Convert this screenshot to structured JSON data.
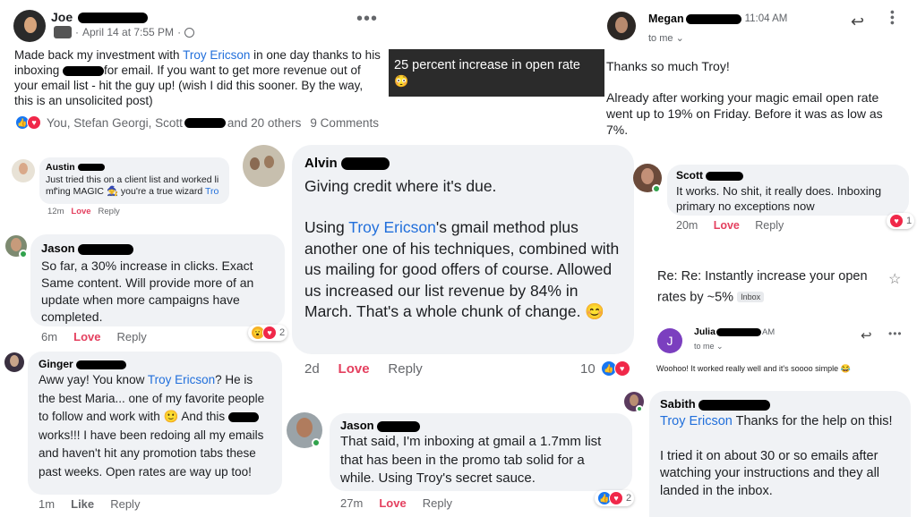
{
  "post": {
    "name": "Joe",
    "date": "April 14 at 7:55 PM",
    "sep": "·",
    "globe_icon": "globe-icon",
    "text_1": "Made back my investment with ",
    "link": "Troy Ericson",
    "text_2": " in one day thanks to his inboxing ",
    "text_3": "for email. If you want to get more revenue out of your email list - hit the guy up! (wish I did this sooner. By the way, this is an unsolicited post)",
    "reactions_text": "You, Stefan Georgi, Scott",
    "reactions_tail": "and 20 others",
    "comments": "9 Comments"
  },
  "banner": {
    "text": "25 percent increase in open rate",
    "emoji": "😳"
  },
  "megan_email": {
    "name": "Megan",
    "time": "11:04 AM",
    "to": "to me",
    "greeting": "Thanks so much Troy!",
    "body": "Already after working your magic email open rate went up to 19% on Friday. Before it was as low as 7%."
  },
  "austin": {
    "name": "Austin",
    "text_1": "Just tried this on a client list and worked li",
    "text_2": "mf'ing MAGIC ",
    "emoji": "🧙",
    "text_3": " you're a true wizard ",
    "link": "Tro",
    "time": "12m",
    "love": "Love",
    "reply": "Reply"
  },
  "jason1": {
    "name": "Jason",
    "text": "So far, a 30% increase in clicks.  Exact Same content. Will provide more of an update when more campaigns have completed.",
    "time": "6m",
    "love": "Love",
    "reply": "Reply",
    "react_count": "2"
  },
  "alvin": {
    "name": "Alvin",
    "line1": "Giving credit where it's due.",
    "text_1": "Using ",
    "link": "Troy Ericson",
    "text_2": "'s gmail method plus another one of his techniques, combined with us mailing for good offers of course. Allowed us increased our list revenue by 84% in March. That's a whole chunk of change. ",
    "emoji": "😊",
    "time": "2d",
    "love": "Love",
    "reply": "Reply",
    "react_count": "10"
  },
  "scott": {
    "name": "Scott",
    "text": "It works. No shit, it really does. Inboxing primary no exceptions now",
    "time": "20m",
    "love": "Love",
    "reply": "Reply",
    "react_count": "1"
  },
  "julia_email": {
    "subject": "Re: Re: Instantly increase your open rates by ~5%",
    "badge": "Inbox",
    "name": "Julia",
    "time": "AM",
    "to": "to me",
    "avatar_letter": "J",
    "body": "Woohoo! It worked really well and it's soooo simple ",
    "emoji": "😂"
  },
  "ginger": {
    "name": "Ginger",
    "text_1": "Aww yay! You know ",
    "link": "Troy Ericson",
    "text_2": "? He is the best Maria... one of my favorite people to follow and work with ",
    "emoji": "🙂",
    "text_3": " And this ",
    "text_4": " works!!! I have been redoing all my emails and haven't hit any promotion tabs these past weeks. Open rates are way up too!",
    "time": "1m",
    "like": "Like",
    "reply": "Reply"
  },
  "jason2": {
    "name": "Jason",
    "text": "That said, I'm inboxing at gmail a 1.7mm list that has been in the promo tab solid for a while. Using Troy's secret sauce.",
    "time": "27m",
    "love": "Love",
    "reply": "Reply",
    "react_count": "2"
  },
  "sabith": {
    "name": "Sabith",
    "link": "Troy Ericson",
    "text_1": " Thanks for the help on this!",
    "text_2": "I tried it on about 30 or so emails after watching your instructions and they all landed in the inbox."
  },
  "icons": {
    "more": "more-options-icon",
    "reply": "reply-arrow-icon",
    "star": "star-icon",
    "chevron": "chevron-down-icon"
  },
  "colors": {
    "link": "#216fdb",
    "love": "#e4405f",
    "bubble": "#f0f2f5",
    "online": "#31a24c"
  }
}
